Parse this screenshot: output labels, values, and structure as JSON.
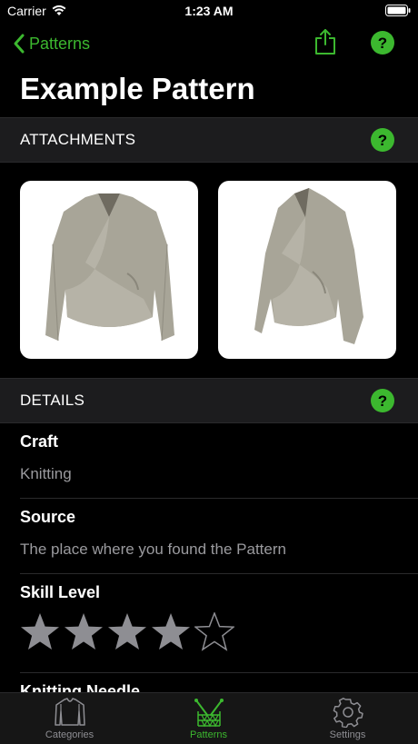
{
  "status_bar": {
    "carrier": "Carrier",
    "time": "1:23 AM"
  },
  "nav": {
    "back_label": "Patterns"
  },
  "page_title": "Example Pattern",
  "sections": {
    "attachments": "ATTACHMENTS",
    "details": "DETAILS"
  },
  "details": [
    {
      "label": "Craft",
      "value": "Knitting"
    },
    {
      "label": "Source",
      "value": "The place where you found the Pattern"
    },
    {
      "label": "Skill Level",
      "rating": 4,
      "max": 5
    },
    {
      "label": "Knitting Needle"
    }
  ],
  "tabs": [
    {
      "label": "Categories",
      "icon": "sweater-icon"
    },
    {
      "label": "Patterns",
      "icon": "knitting-icon",
      "active": true
    },
    {
      "label": "Settings",
      "icon": "gear-icon"
    }
  ],
  "colors": {
    "accent": "#3cb82f",
    "background": "#000000",
    "section": "#1c1c1e",
    "secondary_text": "#9a9a9e",
    "star": "#8e8e93"
  }
}
